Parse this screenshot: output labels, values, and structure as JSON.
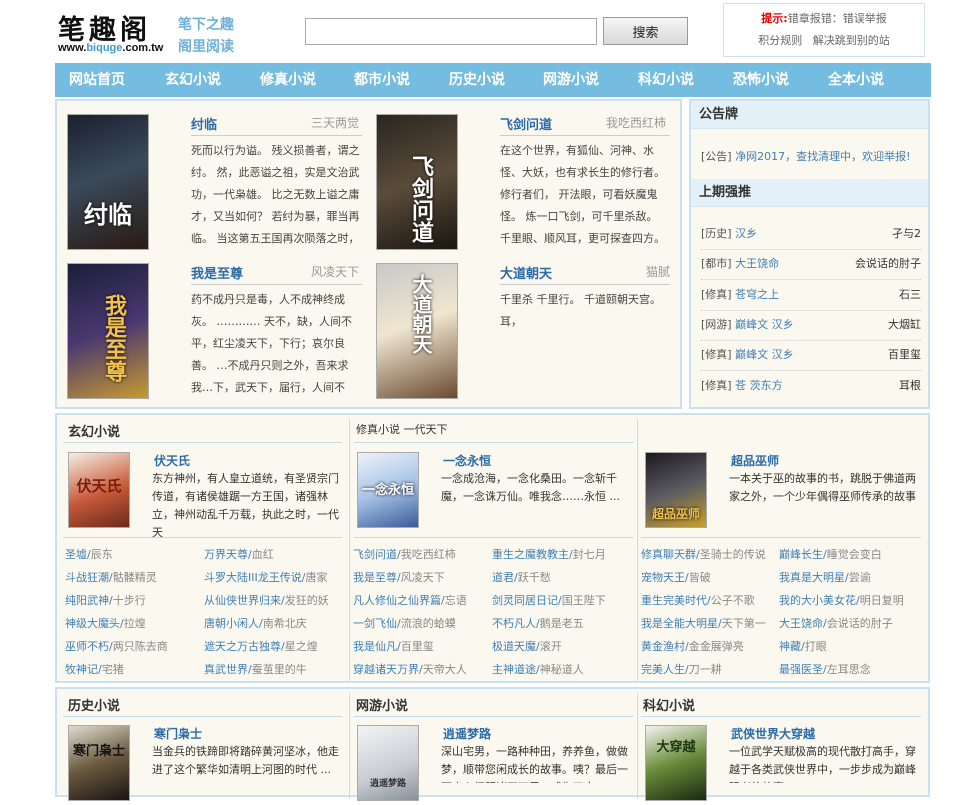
{
  "header": {
    "logo_text": "笔趣阁",
    "logo_url_prefix": "www.",
    "logo_url_highlight": "biquge",
    "logo_url_suffix": ".com.tw",
    "slogan_line1": "笔下之趣",
    "slogan_line2": "阁里阅读",
    "search_placeholder": "",
    "search_button": "搜索",
    "notice_label": "提示:",
    "notice_text": "错章报错：错误举报",
    "notice_link1": "积分规则",
    "notice_link2": "解决跳到别的站"
  },
  "nav": [
    "网站首页",
    "玄幻小说",
    "修真小说",
    "都市小说",
    "历史小说",
    "网游小说",
    "科幻小说",
    "恐怖小说",
    "全本小说"
  ],
  "hot_books": [
    {
      "title": "纣临",
      "author": "三天两觉",
      "cover_text": "纣临",
      "desc": "死而以行为谥。 残义损善者，谓之纣。 然，此恶谥之祖，实是文治武功，一代枭雄。 比之无数上谥之庸才，又当如何？ 若纣为暴，罪当再临。 当这第五王国再次陨落之时，"
    },
    {
      "title": "飞剑问道",
      "author": "我吃西红柿",
      "cover_text": "飞剑问道",
      "desc": "在这个世界，有狐仙、河神、水怪、大妖，也有求长生的修行者。 修行者们， 开法眼，可看妖魔鬼怪。 炼一口飞剑，可千里杀敌。 千里眼、顺风耳，更可探查四方。 ……"
    },
    {
      "title": "我是至尊",
      "author": "风凌天下",
      "cover_text": "我是至尊",
      "desc": "药不成丹只是毒，人不成神终成灰。 ………… 天不，缺，人间不平，红尘凌天下，下行；哀尔良善。 …不成丹只则之外，吾来求我…下，武天下，届行，人间不平，心中有情，判外，"
    },
    {
      "title": "大道朝天",
      "author": "猫腻",
      "cover_text": "大道朝天",
      "desc": "千里杀 千里行。 千道颐朝天宫。 耳，"
    }
  ],
  "notice_board": {
    "title": "公告牌",
    "item_cat": "[公告]",
    "item_text": "净网2017，查找清理中，欢迎举报!"
  },
  "rankings": {
    "title": "上期强推",
    "items": [
      {
        "cat": "[历史]",
        "book": "汉乡",
        "author": "孑与2"
      },
      {
        "cat": "[都市]",
        "book": "大王饶命",
        "author": "会说话的肘子"
      },
      {
        "cat": "[修真]",
        "book": "苍穹之上",
        "author": "石三"
      },
      {
        "cat": "[网游]",
        "book": "巅峰文 汉乡",
        "author": "大烟缸"
      },
      {
        "cat": "[修真]",
        "book": "巅峰文 汉乡",
        "author": "百里玺"
      },
      {
        "cat": "[修真]",
        "book": "苍 茨东方",
        "author": "耳根"
      }
    ]
  },
  "categories": [
    {
      "name": "玄幻小说",
      "feature": {
        "title": "伏天氏",
        "cover_text": "伏天氏",
        "desc": "东方神州，有人皇立道统，有圣贤宗门传道，有诸侯雄踞一方王国，诸强林立，神州动乱千万载，执此之时，一代天"
      },
      "links": [
        [
          "圣墟",
          "辰东"
        ],
        [
          "万界天尊",
          "血红"
        ],
        [
          "斗战狂潮",
          "骷髅精灵"
        ],
        [
          "斗罗大陆III龙王传说",
          "唐家"
        ],
        [
          "纯阳武神",
          "十步行"
        ],
        [
          "从仙侠世界归来",
          "发狂的妖"
        ],
        [
          "神级大魔头",
          "拉煌"
        ],
        [
          "唐朝小闲人",
          "南希北庆"
        ],
        [
          "巫师不朽",
          "两只陈去商"
        ],
        [
          "遮天之万古独尊",
          "星之煌"
        ],
        [
          "牧神记",
          "宅猪"
        ],
        [
          "真武世界",
          "蚕茧里的牛"
        ]
      ]
    },
    {
      "name": "修真小说",
      "overlay": "修真小说 一代天下",
      "feature": {
        "title": "一念永恒",
        "cover_text": "一念永恒",
        "desc": "一念成沧海，一念化桑田。一念斩千魔，一念诛万仙。唯我念……永恒 ..."
      },
      "links": [
        [
          "飞剑问道",
          "我吃西红柿"
        ],
        [
          "重生之魔教教主",
          "封七月"
        ],
        [
          "我是至尊",
          "风凌天下"
        ],
        [
          "道君",
          "跃千愁"
        ],
        [
          "凡人修仙之仙界篇",
          "忘语"
        ],
        [
          "剑灵同居日记",
          "国王陛下"
        ],
        [
          "一剑飞仙",
          "流浪的蛤蟆"
        ],
        [
          "不朽凡人",
          "鹅是老五"
        ],
        [
          "我是仙凡",
          "百里玺"
        ],
        [
          "极道天魔",
          "滚开"
        ],
        [
          "穿越诸天万界",
          "天帝大人"
        ],
        [
          "主神道途",
          "神秘道人"
        ]
      ]
    },
    {
      "name": "都市小说",
      "feature": {
        "title": "超品巫师",
        "cover_text": "超品巫师",
        "desc": "一本关于巫的故事的书，跳脱于佛道两家之外，一个少年偶得巫师传承的故事 ..."
      },
      "links": [
        [
          "修真聊天群",
          "圣骑士的传说"
        ],
        [
          "巅峰长生",
          "睡觉会变白"
        ],
        [
          "宠物天王",
          "皆破"
        ],
        [
          "我真是大明星",
          "尝谕"
        ],
        [
          "重生完美时代",
          "公子不歌"
        ],
        [
          "我的大小美女花",
          "明日复明"
        ],
        [
          "我是全能大明星",
          "天下第一"
        ],
        [
          "大王饶命",
          "会说话的肘子"
        ],
        [
          "黄金渔村",
          "金金展弹亮"
        ],
        [
          "神藏",
          "打眼"
        ],
        [
          "完美人生",
          "刀一耕"
        ],
        [
          "最强医圣",
          "左耳思念"
        ]
      ]
    }
  ],
  "bottom_categories": [
    {
      "name": "历史小说",
      "feature": {
        "title": "寒门枭士",
        "cover_text": "寒门枭士",
        "desc": "当金兵的铁蹄即将踏碎黄河坚冰，他走进了这个繁华如清明上河图的时代 ..."
      }
    },
    {
      "name": "网游小说",
      "feature": {
        "title": "逍遥梦路",
        "cover_text": "逍遥梦路",
        "desc": "深山宅男，一路种种田，养养鱼，做做梦，顺带您闲成长的故事。咦？最后一不小心征服诸天万界，成为了大BOSS？草菲"
      }
    },
    {
      "name": "科幻小说",
      "feature": {
        "title": "武侠世界大穿越",
        "cover_text": "大穿越",
        "desc": "一位武学天赋极高的现代散打高手，穿越于各类武侠世界中，一步步成为巅峰强者的故事。"
      }
    }
  ]
}
